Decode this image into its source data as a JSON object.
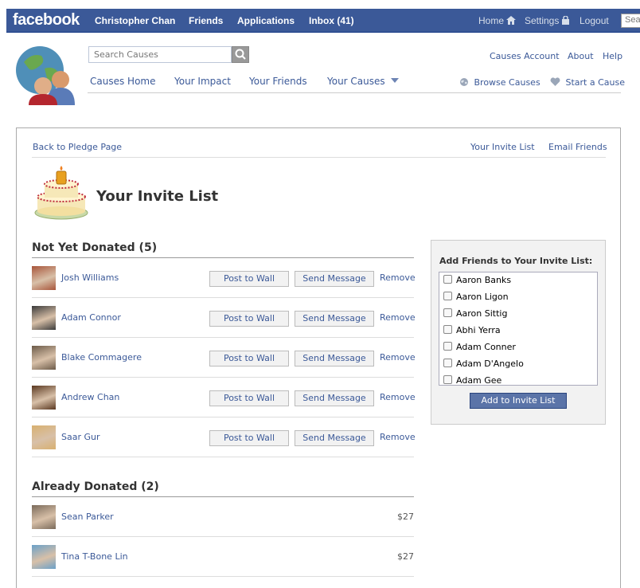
{
  "topbar": {
    "logo": "facebook",
    "nav": [
      "Christopher Chan",
      "Friends",
      "Applications",
      "Inbox (41)"
    ],
    "right": [
      "Home",
      "Settings",
      "Logout"
    ],
    "search_placeholder": "Search"
  },
  "causes_header": {
    "search_placeholder": "Search Causes",
    "nav": [
      "Causes Home",
      "Your Impact",
      "Your Friends",
      "Your Causes"
    ],
    "top_links": [
      "Causes Account",
      "About",
      "Help"
    ],
    "browse": "Browse Causes",
    "start": "Start a Cause"
  },
  "crumbs": {
    "back": "Back to Pledge Page",
    "invite_list": "Your Invite List",
    "email": "Email Friends"
  },
  "page": {
    "title": "Your Invite List"
  },
  "not_donated": {
    "title": "Not Yet Donated (5)",
    "post_label": "Post to Wall",
    "message_label": "Send Message",
    "remove_label": "Remove",
    "people": [
      {
        "name": "Josh Williams",
        "avatar_color": "#a8553a"
      },
      {
        "name": "Adam Connor",
        "avatar_color": "#3a3a3a"
      },
      {
        "name": "Blake Commagere",
        "avatar_color": "#6b5a48"
      },
      {
        "name": "Andrew Chan",
        "avatar_color": "#5a3820"
      },
      {
        "name": "Saar Gur",
        "avatar_color": "#d8b070"
      }
    ]
  },
  "donated": {
    "title": "Already Donated (2)",
    "people": [
      {
        "name": "Sean Parker",
        "amount": "$27",
        "avatar_color": "#7a6a5a"
      },
      {
        "name": "Tina T-Bone Lin",
        "amount": "$27",
        "avatar_color": "#6aa0c8"
      }
    ]
  },
  "sidebox": {
    "title": "Add Friends to Your Invite List:",
    "friends": [
      "Aaron Banks",
      "Aaron Ligon",
      "Aaron Sittig",
      "Abhi Yerra",
      "Adam Conner",
      "Adam D'Angelo",
      "Adam Gee"
    ],
    "button": "Add to Invite List"
  }
}
